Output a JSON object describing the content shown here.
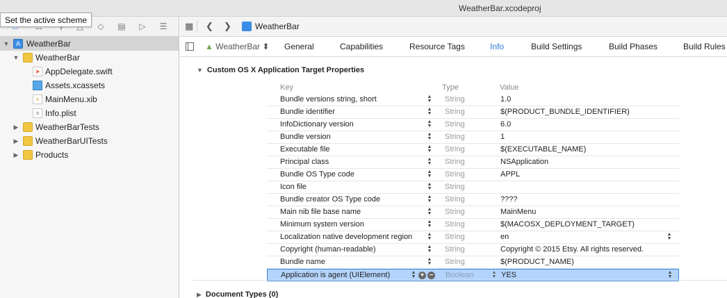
{
  "window": {
    "title": "WeatherBar.xcodeproj"
  },
  "tooltip": {
    "text": "Set the active scheme"
  },
  "navigator": {
    "items": [
      {
        "label": "WeatherBar",
        "kind": "project",
        "level": 0,
        "expanded": true,
        "selected": true
      },
      {
        "label": "WeatherBar",
        "kind": "folder",
        "level": 1,
        "expanded": true
      },
      {
        "label": "AppDelegate.swift",
        "kind": "swift",
        "level": 2
      },
      {
        "label": "Assets.xcassets",
        "kind": "assets",
        "level": 2
      },
      {
        "label": "MainMenu.xib",
        "kind": "xib",
        "level": 2
      },
      {
        "label": "Info.plist",
        "kind": "plist",
        "level": 2
      },
      {
        "label": "WeatherBarTests",
        "kind": "folder",
        "level": 1,
        "expanded": false
      },
      {
        "label": "WeatherBarUITests",
        "kind": "folder",
        "level": 1,
        "expanded": false
      },
      {
        "label": "Products",
        "kind": "folder",
        "level": 1,
        "expanded": false
      }
    ]
  },
  "jumpbar": {
    "crumb": "WeatherBar"
  },
  "tabs": {
    "target": "WeatherBar ⬍",
    "items": [
      "General",
      "Capabilities",
      "Resource Tags",
      "Info",
      "Build Settings",
      "Build Phases",
      "Build Rules"
    ],
    "active": "Info"
  },
  "section": {
    "title": "Custom OS X Application Target Properties",
    "columns": {
      "key": "Key",
      "type": "Type",
      "value": "Value"
    },
    "rows": [
      {
        "key": "Bundle versions string, short",
        "type": "String",
        "value": "1.0"
      },
      {
        "key": "Bundle identifier",
        "type": "String",
        "value": "$(PRODUCT_BUNDLE_IDENTIFIER)"
      },
      {
        "key": "InfoDictionary version",
        "type": "String",
        "value": "6.0"
      },
      {
        "key": "Bundle version",
        "type": "String",
        "value": "1"
      },
      {
        "key": "Executable file",
        "type": "String",
        "value": "$(EXECUTABLE_NAME)"
      },
      {
        "key": "Principal class",
        "type": "String",
        "value": "NSApplication"
      },
      {
        "key": "Bundle OS Type code",
        "type": "String",
        "value": "APPL"
      },
      {
        "key": "Icon file",
        "type": "String",
        "value": ""
      },
      {
        "key": "Bundle creator OS Type code",
        "type": "String",
        "value": "????"
      },
      {
        "key": "Main nib file base name",
        "type": "String",
        "value": "MainMenu"
      },
      {
        "key": "Minimum system version",
        "type": "String",
        "value": "$(MACOSX_DEPLOYMENT_TARGET)"
      },
      {
        "key": "Localization native development region",
        "type": "String",
        "value": "en",
        "value_stepper": true
      },
      {
        "key": "Copyright (human-readable)",
        "type": "String",
        "value": "Copyright © 2015 Etsy. All rights reserved."
      },
      {
        "key": "Bundle name",
        "type": "String",
        "value": "$(PRODUCT_NAME)"
      },
      {
        "key": "Application is agent (UIElement)",
        "type": "Boolean",
        "value": "YES",
        "selected": true,
        "value_stepper": true
      }
    ]
  },
  "section2": {
    "title": "Document Types (0)"
  },
  "colors": {
    "accent": "#2e7bd6",
    "selection": "#b3d4fc",
    "selection_border": "#3a86e0",
    "folder": "#f1c642"
  }
}
